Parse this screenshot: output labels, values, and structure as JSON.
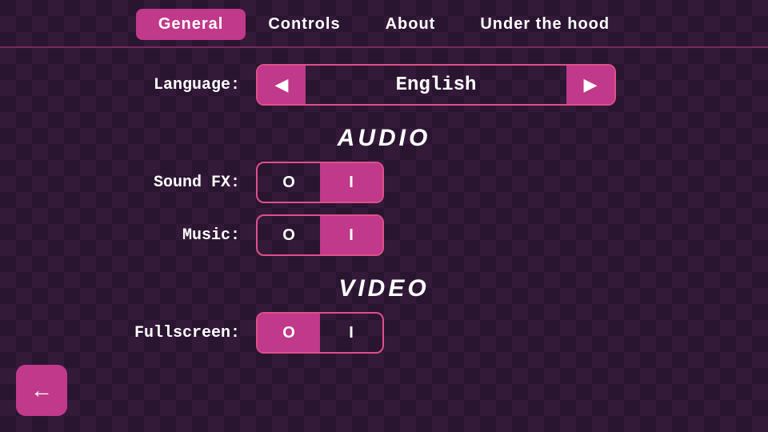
{
  "nav": {
    "tabs": [
      {
        "label": "General",
        "active": true
      },
      {
        "label": "Controls",
        "active": false
      },
      {
        "label": "About",
        "active": false
      },
      {
        "label": "Under the hood",
        "active": false
      }
    ]
  },
  "settings": {
    "language": {
      "label": "Language:",
      "value": "English",
      "left_arrow": "◀",
      "right_arrow": "▶"
    },
    "audio_header": "AUDIO",
    "sound_fx": {
      "label": "Sound FX:",
      "off_label": "O",
      "on_label": "I",
      "state": "on"
    },
    "music": {
      "label": "Music:",
      "off_label": "O",
      "on_label": "I",
      "state": "on"
    },
    "video_header": "VIDEO",
    "fullscreen": {
      "label": "Fullscreen:",
      "off_label": "O",
      "on_label": "I",
      "state": "off"
    }
  },
  "back_button": "←",
  "colors": {
    "accent": "#c0398a",
    "border": "#e0508a"
  }
}
